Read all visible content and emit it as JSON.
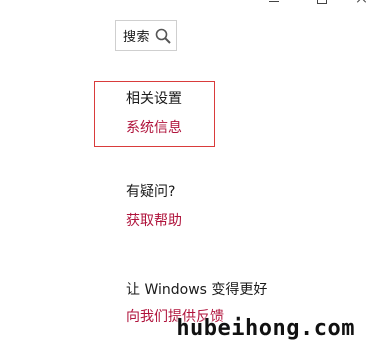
{
  "search": {
    "label": "搜索",
    "icon": "search-icon"
  },
  "related_settings": {
    "heading": "相关设置",
    "link": "系统信息"
  },
  "help": {
    "heading": "有疑问?",
    "link": "获取帮助"
  },
  "feedback": {
    "heading": "让 Windows 变得更好",
    "link": "向我们提供反馈"
  },
  "watermark": "hubeihong.com",
  "colors": {
    "link": "#b0143c",
    "highlight_border": "#d93b3b",
    "text": "#1a1a1a"
  }
}
